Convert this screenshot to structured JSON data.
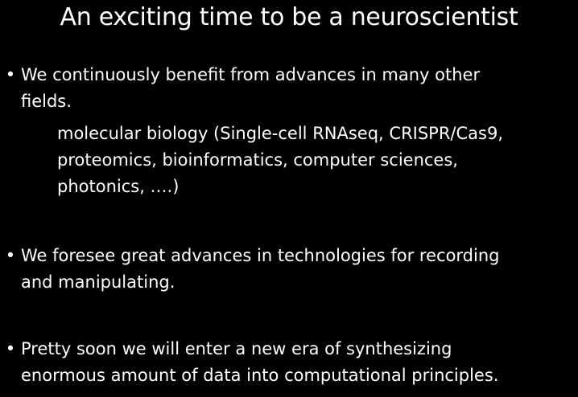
{
  "slide": {
    "title": "An exciting time to be a neuroscientist",
    "bullet_symbol": "•",
    "bullets": [
      {
        "text": "We continuously benefit from advances in many other\nfields.",
        "sub": "molecular biology (Single-cell RNAseq, CRISPR/Cas9,\nproteomics, bioinformatics, computer sciences,\nphotonics, ….)"
      },
      {
        "text": "We foresee great advances in technologies for recording\nand manipulating."
      },
      {
        "text": "Pretty soon we will enter a new era of synthesizing\nenormous amount of data into computational principles."
      }
    ]
  },
  "colors": {
    "background": "#000000",
    "text": "#ffffff"
  }
}
